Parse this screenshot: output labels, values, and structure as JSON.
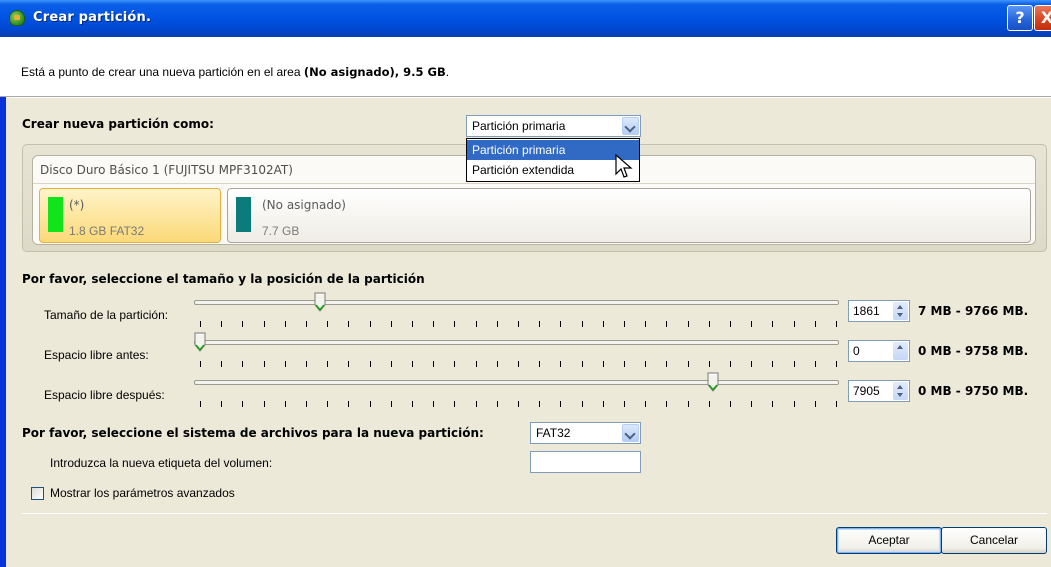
{
  "window": {
    "title": "Crear partición.",
    "help_glyph": "?",
    "close_glyph": "X"
  },
  "intro": {
    "prefix": "Está a punto de crear una nueva partición en el area ",
    "bold": "(No asignado), 9.5 GB",
    "suffix": "."
  },
  "partition_type": {
    "label": "Crear nueva partición como:",
    "selected": "Partición primaria",
    "options": [
      "Partición primaria",
      "Partición extendida"
    ],
    "highlighted": "Partición primaria"
  },
  "disk": {
    "title": "Disco Duro Básico 1 (FUJITSU MPF3102AT)",
    "partitions": [
      {
        "name": "(*)",
        "detail": "1.8 GB FAT32",
        "color": "#11e41a",
        "selected": true
      },
      {
        "name": "(No asignado)",
        "detail": "7.7 GB",
        "color": "#0b7b7b",
        "selected": false
      }
    ]
  },
  "size_section": {
    "heading": "Por favor, seleccione el tamaño y la posición de la partición",
    "rows": [
      {
        "label": "Tamaño de la partición:",
        "value": "1861",
        "range": "7 MB - 9766 MB.",
        "slider_fraction": 0.19
      },
      {
        "label": "Espacio libre antes:",
        "value": "0",
        "range": "0 MB - 9758 MB.",
        "slider_fraction": 0.0
      },
      {
        "label": "Espacio libre después:",
        "value": "7905",
        "range": "0 MB - 9750 MB.",
        "slider_fraction": 0.81
      }
    ]
  },
  "filesystem": {
    "label": "Por favor, seleccione el sistema de archivos para la nueva partición:",
    "selected": "FAT32"
  },
  "volume_label": {
    "label": "Introduzca la nueva etiqueta del volumen:",
    "value": ""
  },
  "advanced": {
    "label": "Mostrar los parámetros avanzados",
    "checked": false
  },
  "buttons": {
    "ok": "Aceptar",
    "cancel": "Cancelar"
  }
}
